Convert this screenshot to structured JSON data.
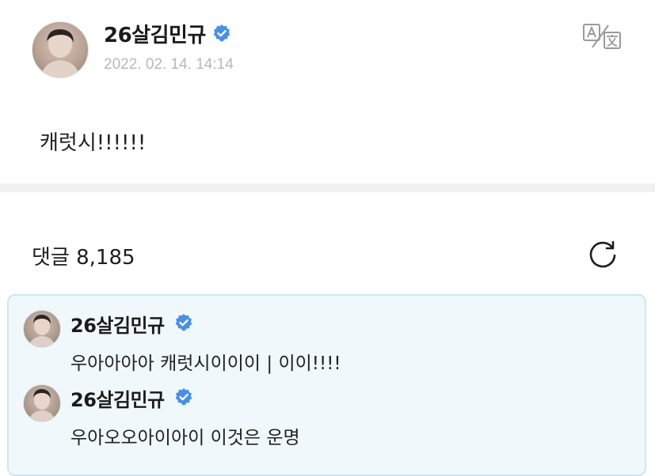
{
  "post": {
    "author": "26살김민규",
    "timestamp": "2022. 02. 14. 14:14",
    "body": "캐럿시!!!!!!",
    "icons": {
      "avatar": "avatar",
      "verified": "verified-badge-icon",
      "translate": "translate-icon"
    }
  },
  "comments_section": {
    "title": "댓글 8,185",
    "refresh_icon": "refresh-icon"
  },
  "artist_comments": [
    {
      "author": "26살김민규",
      "text": "우아아아아 캐럿시이이이 | 이이!!!!"
    },
    {
      "author": "26살김민규",
      "text": "우아오오아이아이 이것은 운명"
    }
  ],
  "colors": {
    "verified": "#4a90e2",
    "artist_box_bg": "#f0f8fc",
    "artist_box_border": "#cfe6f3",
    "timestamp": "#b8b8b8",
    "divider": "#f1f1f3"
  }
}
